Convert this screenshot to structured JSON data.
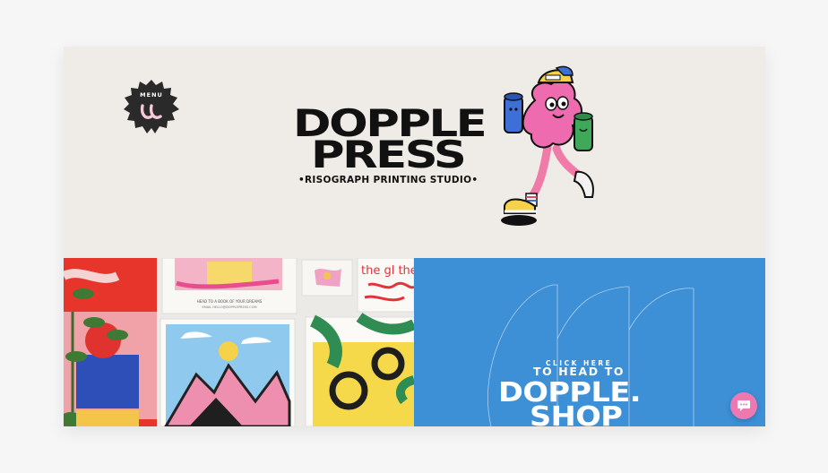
{
  "header": {
    "menu_label": "MENU",
    "brand_line1": "DOPPLE",
    "brand_line2": "PRESS",
    "tagline": "•RISOGRAPH PRINTING STUDIO•"
  },
  "gallery": {
    "poster_top_text": "HEAD TO A BOOK OF YOUR DREAMS",
    "poster_top_subtext": "EMAIL HELLO@DOPPLEPRESS.COM",
    "poster_right_text": "the gl the sm the ci"
  },
  "promo": {
    "click_here": "CLICK HERE",
    "head_to": "TO HEAD TO",
    "shop_line1": "DOPPLE.",
    "shop_line2": "SHOP"
  },
  "colors": {
    "accent_blue": "#3d8fd6",
    "accent_pink": "#ee78b2",
    "ink": "#111111"
  }
}
